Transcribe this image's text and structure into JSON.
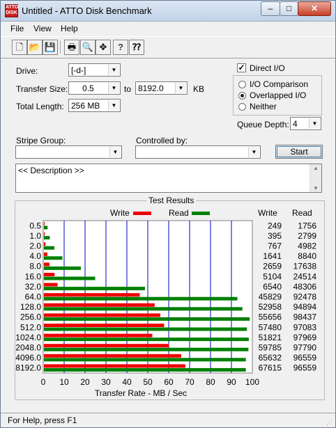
{
  "window": {
    "title": "Untitled - ATTO Disk Benchmark",
    "controls": {
      "minimize": "–",
      "maximize": "□",
      "close": "✕"
    }
  },
  "menu": {
    "items": [
      "File",
      "View",
      "Help"
    ]
  },
  "toolbar": {
    "buttons": [
      {
        "name": "new-file-icon",
        "glyph": "🗋"
      },
      {
        "name": "open-folder-icon",
        "glyph": "📂"
      },
      {
        "name": "save-icon",
        "glyph": "💾"
      },
      {
        "name": "print-icon",
        "glyph": "🖶"
      },
      {
        "name": "print-preview-icon",
        "glyph": "🔍"
      },
      {
        "name": "move-icon",
        "glyph": "✥"
      },
      {
        "name": "help-icon",
        "glyph": "?"
      },
      {
        "name": "context-help-icon",
        "glyph": "⁇"
      }
    ]
  },
  "settings": {
    "drive_label": "Drive:",
    "drive_value": "[-d-]",
    "transfer_size_label": "Transfer Size:",
    "transfer_size_from": "0.5",
    "transfer_size_to_label": "to",
    "transfer_size_to": "8192.0",
    "transfer_size_unit": "KB",
    "total_length_label": "Total Length:",
    "total_length_value": "256 MB",
    "direct_io_label": "Direct I/O",
    "direct_io_checked": true,
    "io_modes": [
      {
        "label": "I/O Comparison",
        "selected": false
      },
      {
        "label": "Overlapped I/O",
        "selected": true
      },
      {
        "label": "Neither",
        "selected": false
      }
    ],
    "queue_depth_label": "Queue Depth:",
    "queue_depth_value": "4",
    "stripe_group_label": "Stripe Group:",
    "stripe_group_value": "",
    "controlled_by_label": "Controlled by:",
    "controlled_by_value": "",
    "start_label": "Start",
    "description_text": "<< Description >>"
  },
  "results": {
    "title": "Test Results",
    "write_legend": "Write",
    "read_legend": "Read",
    "write_col_header": "Write",
    "read_col_header": "Read",
    "xlabel": "Transfer Rate - MB / Sec"
  },
  "colors": {
    "write": "#ee0000",
    "read": "#008000",
    "grid": "#0000c8"
  },
  "chart_data": {
    "type": "bar",
    "orientation": "horizontal",
    "categories": [
      "0.5",
      "1.0",
      "2.0",
      "4.0",
      "8.0",
      "16.0",
      "32.0",
      "64.0",
      "128.0",
      "256.0",
      "512.0",
      "1024.0",
      "2048.0",
      "4096.0",
      "8192.0"
    ],
    "series": [
      {
        "name": "Write",
        "values": [
          249,
          395,
          767,
          1641,
          2659,
          5104,
          6540,
          45829,
          52958,
          55656,
          57480,
          51821,
          59785,
          65632,
          67615
        ]
      },
      {
        "name": "Read",
        "values": [
          1756,
          2799,
          4982,
          8840,
          17638,
          24514,
          48306,
          92478,
          94894,
          98437,
          97083,
          97969,
          97790,
          96559,
          96559
        ]
      }
    ],
    "xticks": [
      0,
      10,
      20,
      30,
      40,
      50,
      60,
      70,
      80,
      90,
      100
    ],
    "xlim": [
      0,
      100
    ],
    "xlabel": "Transfer Rate - MB / Sec",
    "value_unit_note": "table values in KB/sec; bars plotted in MB/sec"
  },
  "status": {
    "text": "For Help, press F1"
  }
}
